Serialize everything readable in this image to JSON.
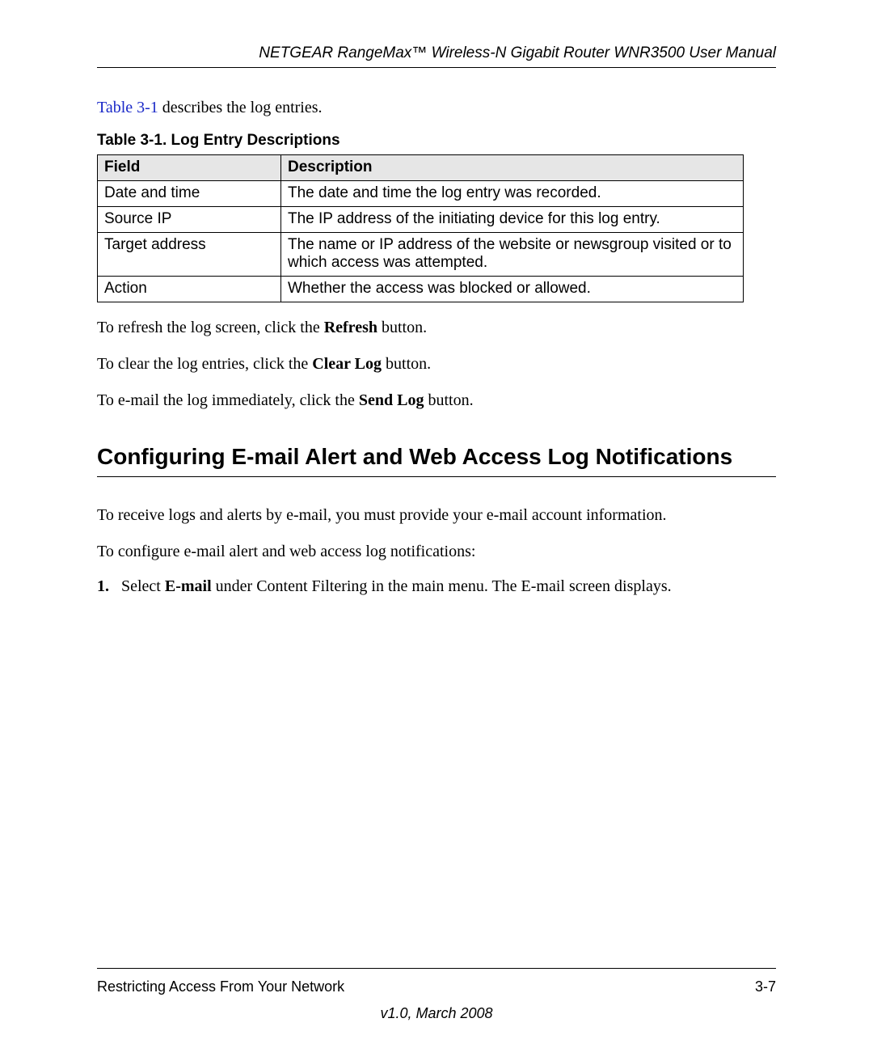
{
  "header": {
    "running_title": "NETGEAR RangeMax™ Wireless-N Gigabit Router WNR3500 User Manual"
  },
  "intro": {
    "link_text": "Table 3-1",
    "rest": " describes the log entries."
  },
  "table": {
    "caption": "Table 3-1.  Log Entry Descriptions",
    "head_field": "Field",
    "head_desc": "Description",
    "rows": [
      {
        "field": "Date and time",
        "desc": "The date and time the log entry was recorded."
      },
      {
        "field": "Source IP",
        "desc": "The IP address of the initiating device for this log entry."
      },
      {
        "field": "Target address",
        "desc": "The name or IP address of the website or newsgroup visited or to which access was attempted."
      },
      {
        "field": "Action",
        "desc": "Whether the access was blocked or allowed."
      }
    ]
  },
  "paras": {
    "refresh_pre": "To refresh the log screen, click the ",
    "refresh_bold": "Refresh",
    "refresh_post": " button.",
    "clear_pre": "To clear the log entries, click the ",
    "clear_bold": "Clear Log",
    "clear_post": " button.",
    "send_pre": "To e-mail the log immediately, click the ",
    "send_bold": "Send Log",
    "send_post": " button."
  },
  "section": {
    "heading": "Configuring E-mail Alert and Web Access Log Notifications",
    "para1": "To receive logs and alerts by e-mail, you must provide your e-mail account information.",
    "para2": "To configure e-mail alert and web access log notifications:",
    "step1_num": "1.",
    "step1_pre": "Select ",
    "step1_bold": "E-mail",
    "step1_post": " under Content Filtering in the main menu. The E-mail screen displays."
  },
  "footer": {
    "left": "Restricting Access From Your Network",
    "right": "3-7",
    "version": "v1.0, March 2008"
  }
}
